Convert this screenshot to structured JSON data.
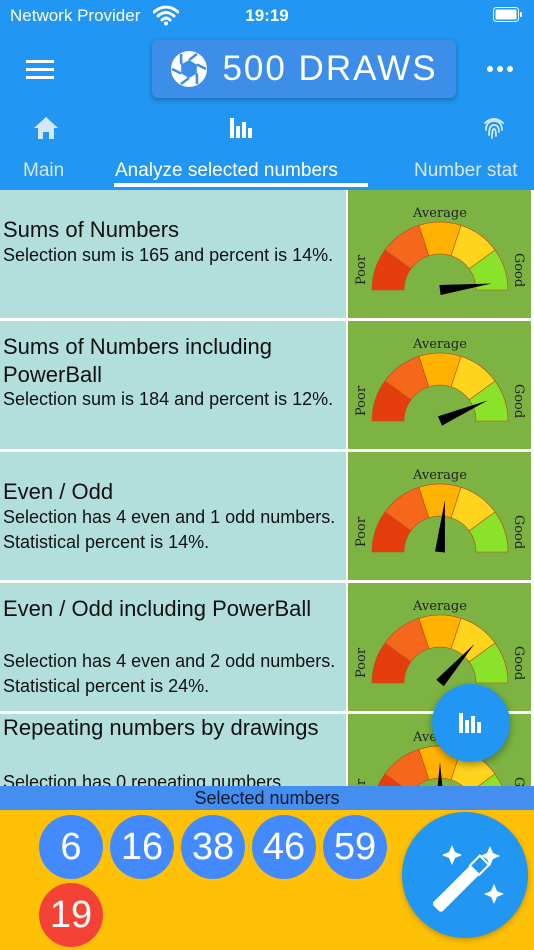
{
  "status_bar": {
    "carrier": "Network Provider",
    "time": "19:19"
  },
  "header": {
    "title": "500 DRAWS"
  },
  "tabs": [
    {
      "label": "Main",
      "icon": "home-icon"
    },
    {
      "label": "Analyze selected numbers",
      "icon": "bar-chart-icon",
      "active": true
    },
    {
      "label": "Number stat",
      "icon": "fingerprint-icon"
    }
  ],
  "gauge_labels": {
    "poor": "Poor",
    "average": "Average",
    "good": "Good"
  },
  "cards": [
    {
      "title": "Sums of Numbers",
      "description": "Selection sum is 165 and percent is 14%.",
      "needle_level": 0.96
    },
    {
      "title": "Sums of Numbers including PowerBall",
      "description": "Selection sum is 184 and percent is 12%.",
      "needle_level": 0.87
    },
    {
      "title": "Even / Odd",
      "description": "Selection has 4 even and 1 odd numbers. Statistical percent is 14%.",
      "needle_level": 0.53
    },
    {
      "title": "Even / Odd including PowerBall",
      "description": "Selection has 4 even and 2 odd numbers. Statistical percent is 24%.",
      "needle_level": 0.73
    },
    {
      "title": "Repeating numbers by drawings",
      "description": "Selection has 0 repeating numbers",
      "needle_level": 0.5
    }
  ],
  "selected_label": "Selected numbers",
  "selected_numbers": [
    "6",
    "16",
    "38",
    "46",
    "59"
  ],
  "powerball": "19",
  "colors": {
    "primary": "#2196f3",
    "card_bg": "#b2dfdb",
    "gauge_bg": "#7cb342",
    "ball": "#448aff",
    "powerball": "#f44336",
    "bottom_bar": "#ffc107"
  }
}
